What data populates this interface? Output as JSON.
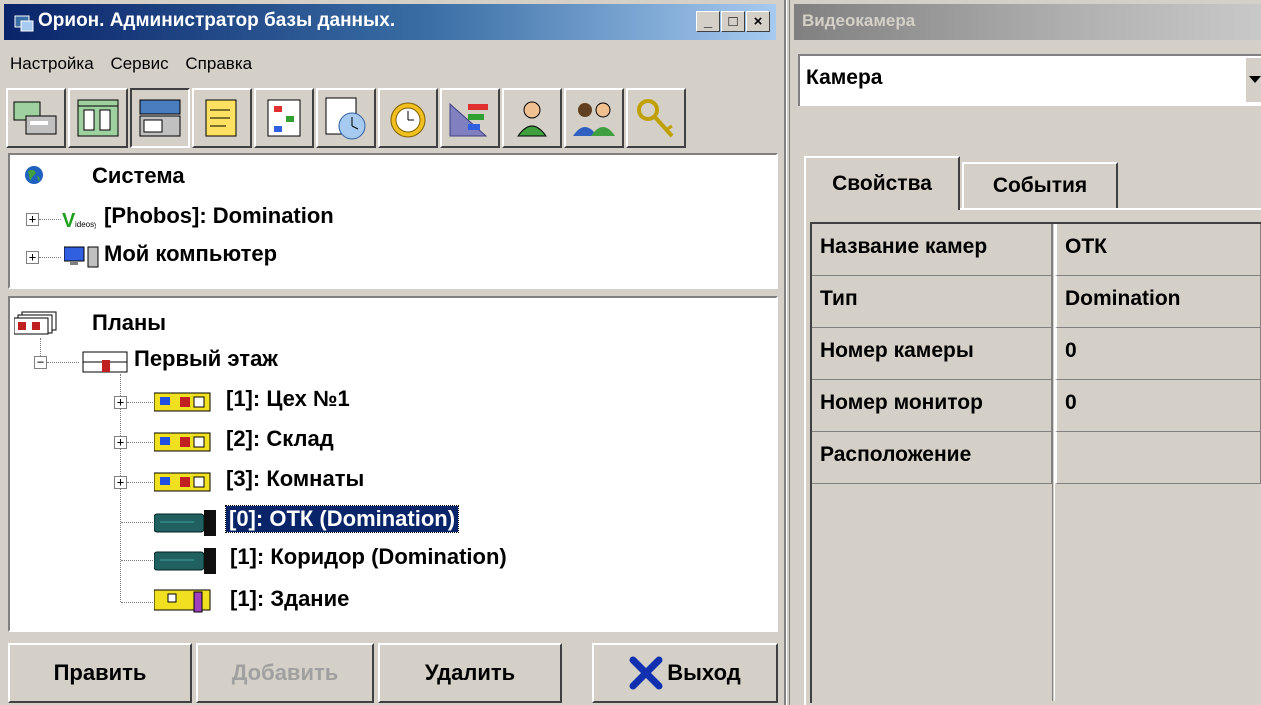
{
  "left_window": {
    "title": "Орион. Администратор базы данных.",
    "window_buttons": {
      "minimize": "_",
      "maximize": "□",
      "close": "×"
    },
    "menu": [
      "Настройка",
      "Сервис",
      "Справка"
    ],
    "toolbar_icons": [
      "devices-icon",
      "network-icon",
      "plans-icon",
      "notes-icon",
      "schema-icon",
      "schedule-icon",
      "alarm-clock-icon",
      "levels-icon",
      "user-icon",
      "users-icon",
      "keys-icon"
    ],
    "system_tree": {
      "root": "Система",
      "items": [
        "[Phobos]: Domination",
        "Мой компьютер"
      ]
    },
    "plans_tree": {
      "root": "Планы",
      "floor": "Первый этаж",
      "items": [
        {
          "label": "[1]: Цех №1",
          "icon": "zone-icon",
          "expandable": true
        },
        {
          "label": "[2]: Склад",
          "icon": "zone-icon",
          "expandable": true
        },
        {
          "label": "[3]: Комнаты",
          "icon": "zone-icon",
          "expandable": true
        },
        {
          "label": "[0]: ОТК (Domination)",
          "icon": "camera-icon",
          "expandable": false,
          "selected": true
        },
        {
          "label": "[1]: Коридор (Domination)",
          "icon": "camera-icon",
          "expandable": false
        },
        {
          "label": "[1]: Здание",
          "icon": "building-icon",
          "expandable": false
        }
      ]
    },
    "buttons": {
      "edit": "Править",
      "add": "Добавить",
      "delete": "Удалить",
      "exit": "Выход"
    }
  },
  "right_window": {
    "title": "Видеокамера",
    "camera_select_value": "Камера",
    "tabs": [
      "Свойства",
      "События"
    ],
    "properties": [
      {
        "key": "Название камер",
        "value": "ОТК"
      },
      {
        "key": "Тип",
        "value": "Domination"
      },
      {
        "key": "Номер камеры",
        "value": "0"
      },
      {
        "key": "Номер монитор",
        "value": "0"
      },
      {
        "key": "Расположение",
        "value": ""
      }
    ]
  },
  "colors": {
    "titlebar_active": "#0a246a",
    "titlebar_inactive": "#808080",
    "face": "#d4d0c8",
    "selection": "#0a246a"
  }
}
